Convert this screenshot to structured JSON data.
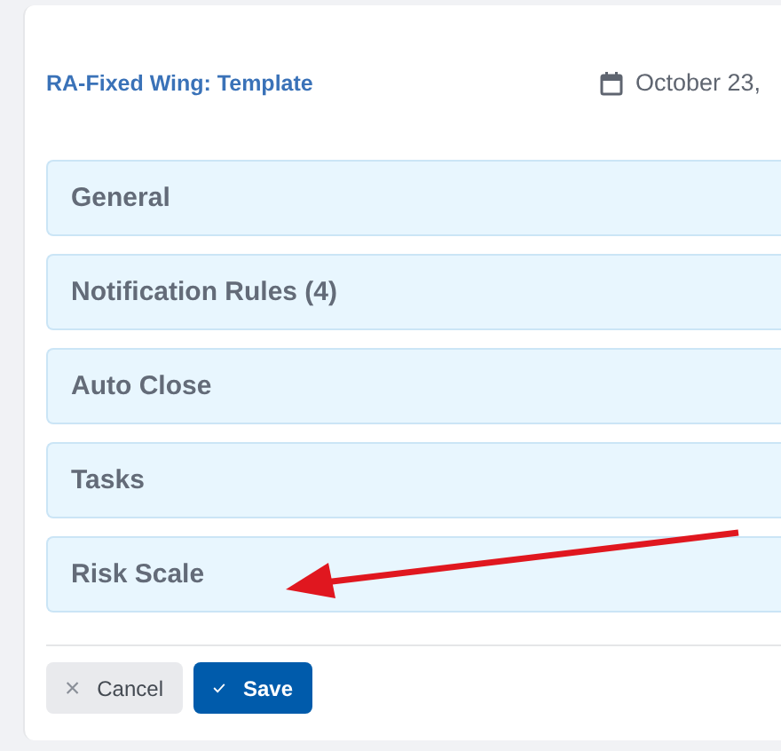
{
  "header": {
    "title": "RA-Fixed Wing: Template",
    "date": "October 23,"
  },
  "sections": [
    {
      "label": "General"
    },
    {
      "label": "Notification Rules (4)"
    },
    {
      "label": "Auto Close"
    },
    {
      "label": "Tasks"
    },
    {
      "label": "Risk Scale"
    }
  ],
  "buttons": [
    {
      "kind": "cancel",
      "label": "Cancel"
    },
    {
      "kind": "save",
      "label": "Save"
    }
  ]
}
